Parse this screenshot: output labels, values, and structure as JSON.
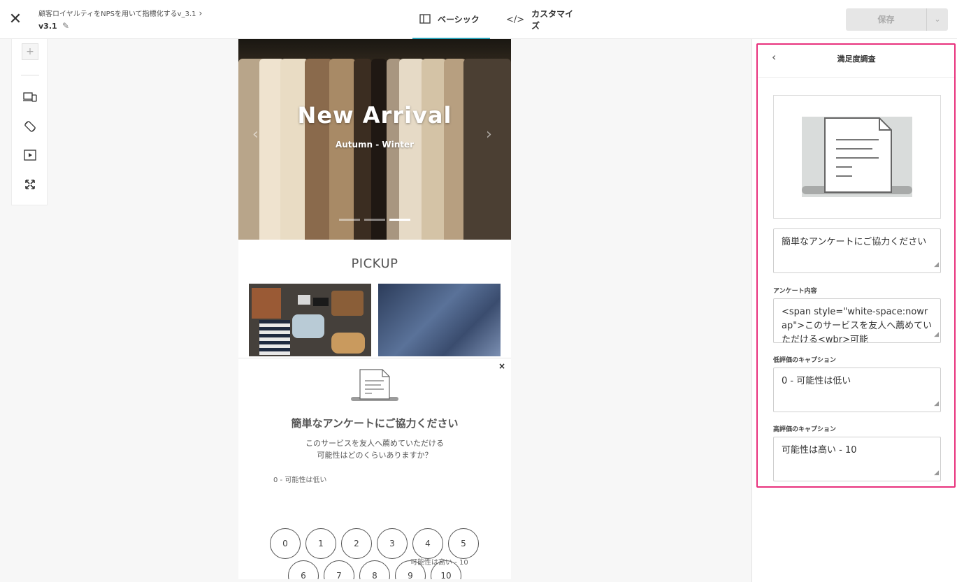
{
  "topbar": {
    "breadcrumb": "顧客ロイヤルティをNPSを用いて指標化するv_3.1",
    "version": "v3.1",
    "tabs": [
      {
        "label": "ベーシック",
        "icon": "layout-icon",
        "active": true
      },
      {
        "label": "カスタマイズ",
        "icon": "code-icon",
        "active": false
      }
    ],
    "save_label": "保存"
  },
  "preview": {
    "hero_title": "New Arrival",
    "hero_subtitle": "Autumn - Winter",
    "slides": 3,
    "active_slide": 3,
    "pickup_label": "PICKUP",
    "popup": {
      "title": "簡単なアンケートにご協力ください",
      "question_line1": "このサービスを友人へ薦めていただける",
      "question_line2": "可能性はどのくらいありますか？",
      "low_caption": "0 - 可能性は低い",
      "high_caption": "可能性は高い - 10",
      "close": "×",
      "scale_row1": [
        "0",
        "1",
        "2",
        "3",
        "4",
        "5"
      ],
      "scale_row2": [
        "6",
        "7",
        "8",
        "9",
        "10"
      ]
    }
  },
  "panel": {
    "title": "満足度調査",
    "title_field_value": "簡単なアンケートにご協力ください",
    "content_label": "アンケート内容",
    "content_value": "<span style=\"white-space:nowrap\">このサービスを友人へ薦めていただける<wbr>可能",
    "low_label": "低評価のキャプション",
    "low_value": "0 - 可能性は低い",
    "high_label": "高評価のキャプション",
    "high_value": "可能性は高い - 10"
  },
  "colors": {
    "accent": "#2aa2b8",
    "highlight": "#e8327d"
  }
}
